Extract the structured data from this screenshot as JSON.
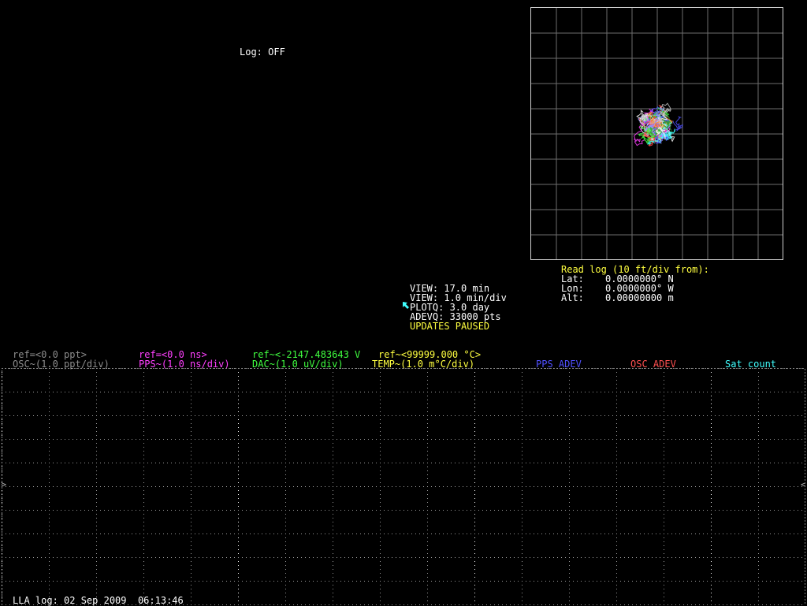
{
  "log_status": "Log: OFF",
  "lla_panel": {
    "title": "Read log (10 ft/div from):",
    "lat_label": "Lat:",
    "lat_value": "0.0000000° N",
    "lon_label": "Lon:",
    "lon_value": "0.0000000° W",
    "alt_label": "Alt:",
    "alt_value": "0.00000000 m"
  },
  "view_info": {
    "view_span": "VIEW: 17.0 min",
    "view_div": "VIEW: 1.0 min/div",
    "plotq": "PLOTQ: 3.0 day",
    "adevq": "ADEVQ: 33000 pts",
    "status": "UPDATES PAUSED"
  },
  "legend": {
    "osc_ref": "ref=<0.0 ppt>",
    "osc_scale": "OSC~(1.0 ppt/div)",
    "pps_ref": "ref=<0.0 ns>",
    "pps_scale": "PPS~(1.0 ns/div)",
    "dac_ref": "ref~<-2147.483643 V",
    "dac_scale": "DAC~(1.0 uV/div)",
    "temp_ref": "ref~<99999.000 °C>",
    "temp_scale": "TEMP~(1.0 m°C/div)",
    "pps_adev": "PPS ADEV",
    "osc_adev": "OSC ADEV",
    "sat_count": "Sat count"
  },
  "footer": {
    "lla_log": "LLA log: 02 Sep 2009  06:13:46"
  },
  "colors": {
    "osc": "#8c8c8c",
    "pps": "#ff40ff",
    "dac": "#40ff40",
    "temp": "#ffff40",
    "pps_adev": "#5050ff",
    "osc_adev": "#ff5050",
    "sat_count": "#40ffff",
    "lla_title": "#ffff40"
  },
  "icons": {
    "mouse_cursor": "mouse-pointer-icon"
  }
}
